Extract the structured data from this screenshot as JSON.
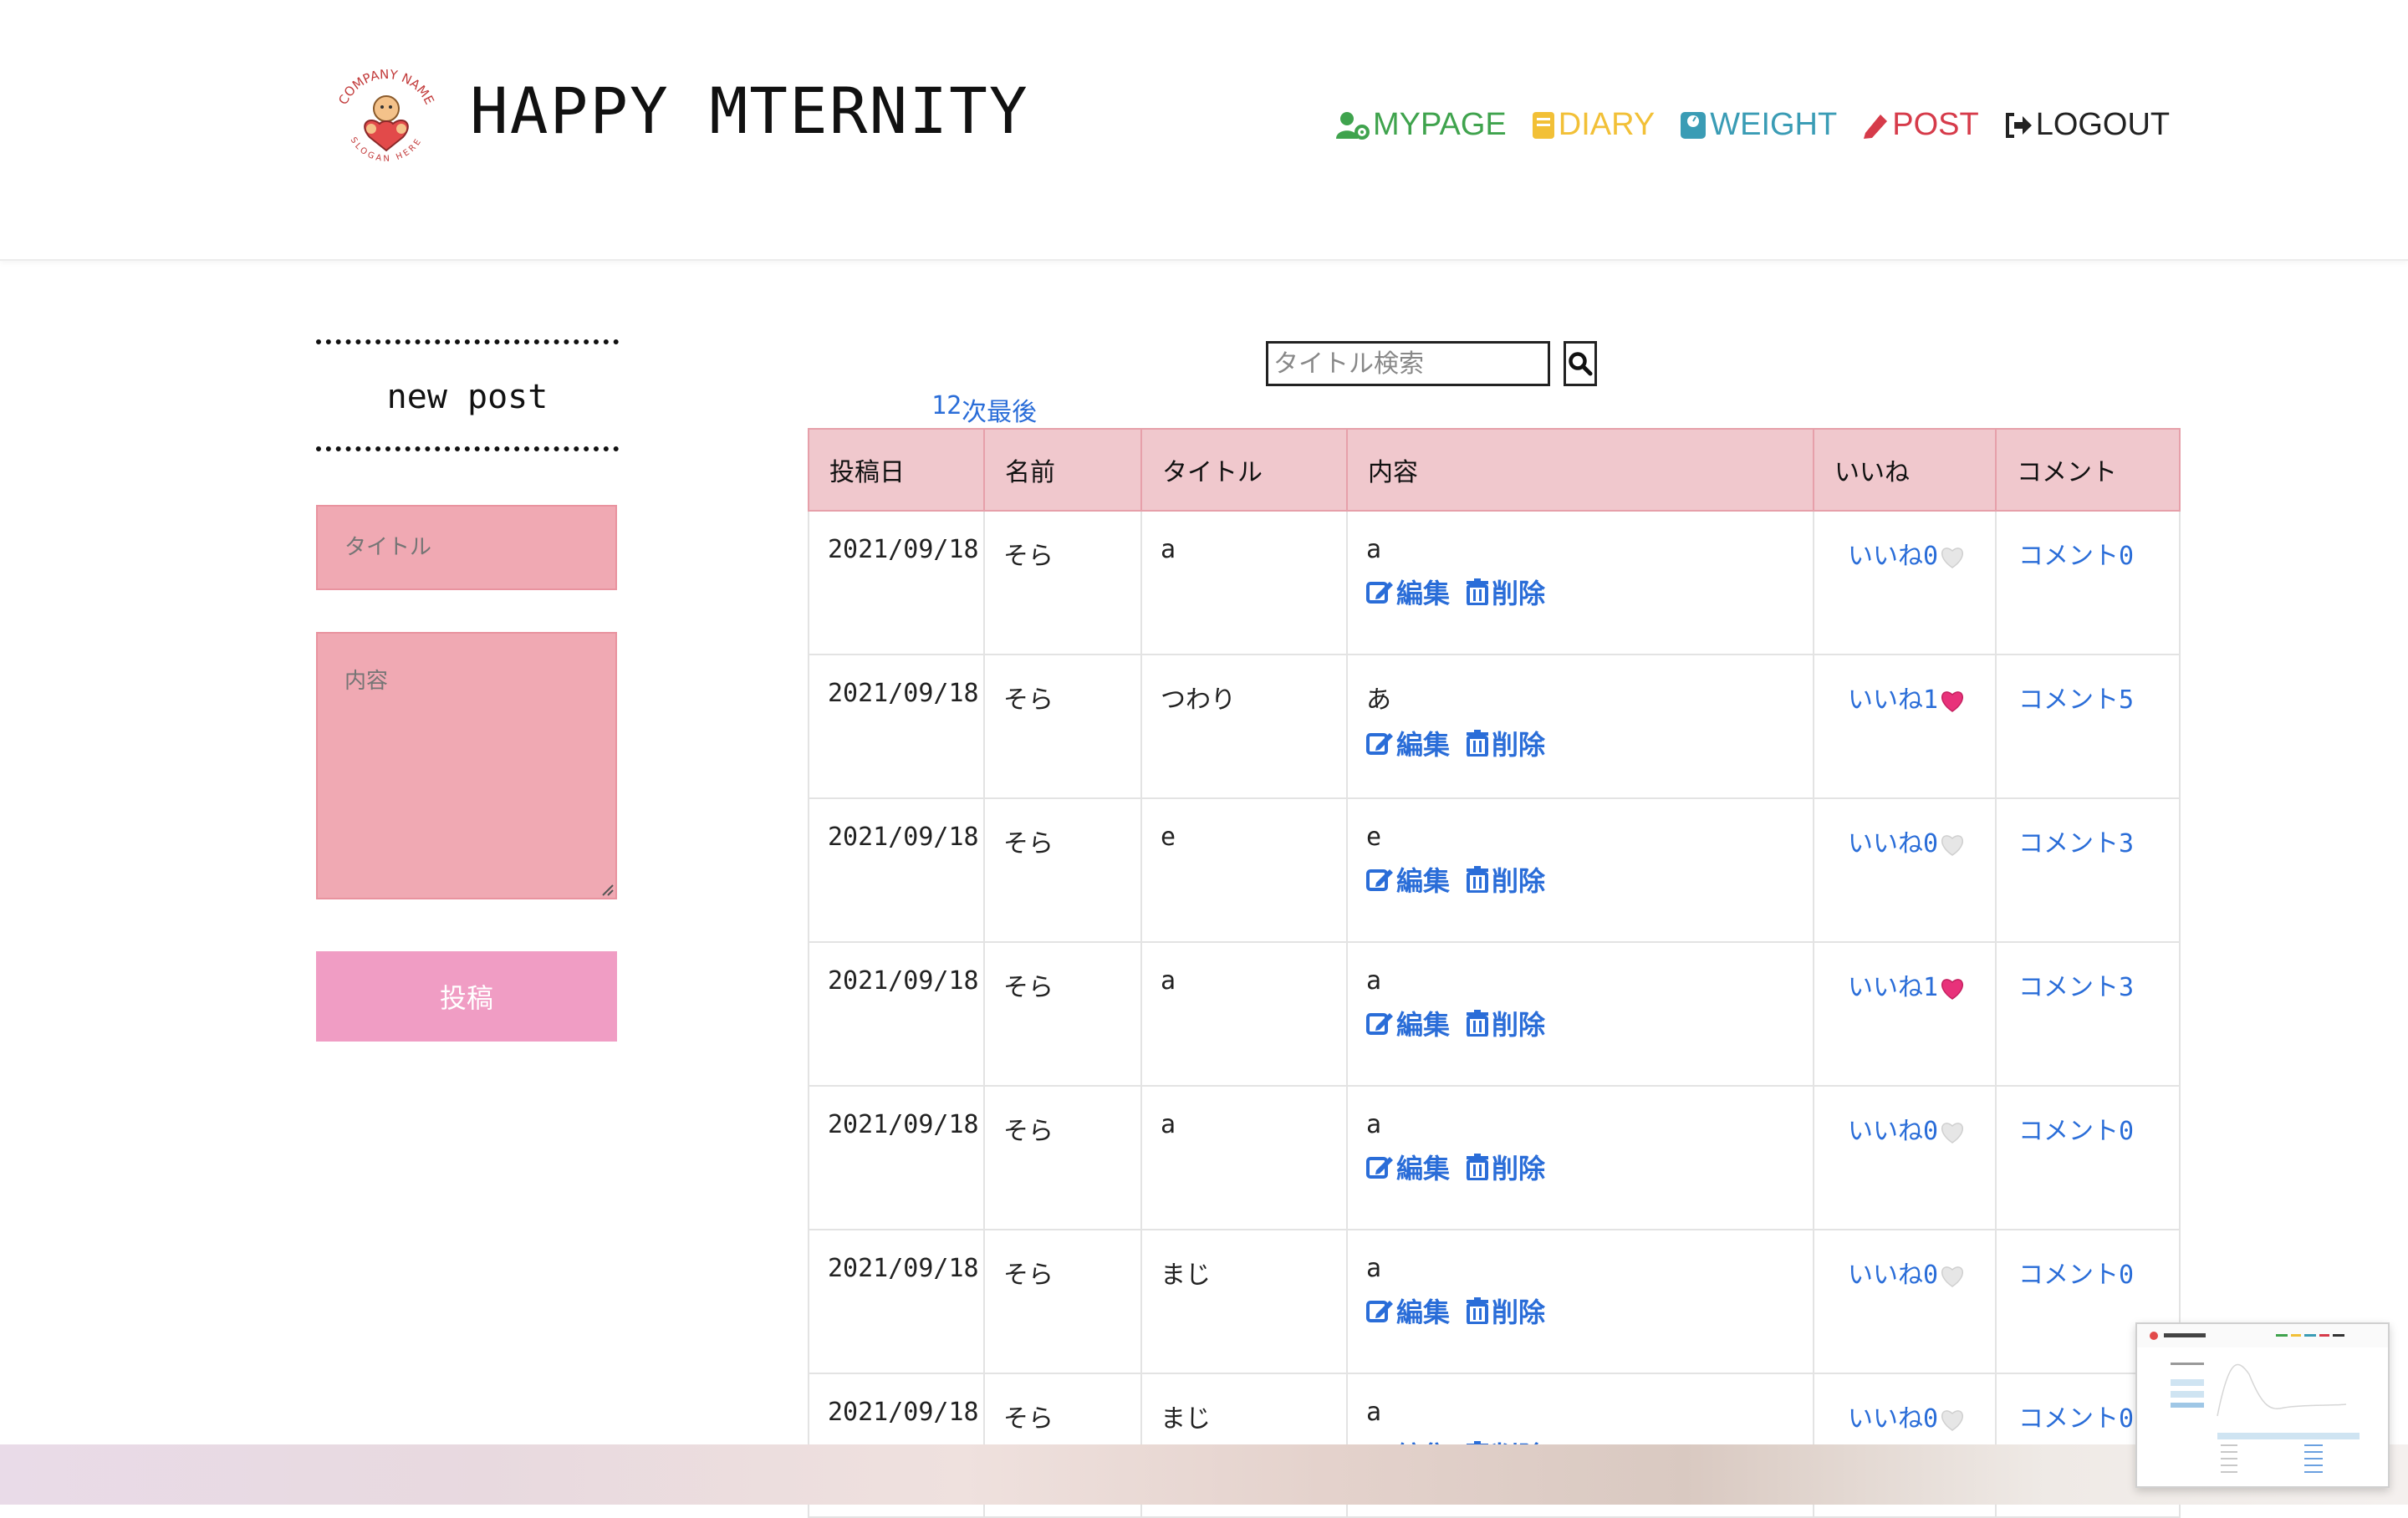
{
  "header": {
    "logo": {
      "icon": "baby-heart-logo",
      "text_top": "COMPANY NAME",
      "text_bottom": "SLOGAN HERE"
    },
    "site_title": "HAPPY MTERNITY",
    "nav": [
      {
        "label": "MYPAGE",
        "icon": "user-gear-icon",
        "color": "#3fa34d"
      },
      {
        "label": "DIARY",
        "icon": "book-icon",
        "color": "#f2c037"
      },
      {
        "label": "WEIGHT",
        "icon": "scale-icon",
        "color": "#3a9cb5"
      },
      {
        "label": "POST",
        "icon": "pencil-icon",
        "color": "#d63b4a"
      },
      {
        "label": "LOGOUT",
        "icon": "sign-out-icon",
        "color": "#222222"
      }
    ]
  },
  "sidebar": {
    "heading": "new post",
    "title_placeholder": "タイトル",
    "content_placeholder": "内容",
    "submit_label": "投稿"
  },
  "search": {
    "placeholder": "タイトル検索",
    "button_icon": "search-icon"
  },
  "pagination": {
    "pages": [
      "1",
      "2"
    ],
    "next": "次",
    "last": "最後"
  },
  "table": {
    "headers": [
      "投稿日",
      "名前",
      "タイトル",
      "内容",
      "いいね",
      "コメント"
    ],
    "edit_label": "編集",
    "delete_label": "削除",
    "rows": [
      {
        "date": "2021/09/18",
        "name": "そら",
        "title": "a",
        "content": "a",
        "like": "いいね0",
        "liked": false,
        "comment": "コメント0"
      },
      {
        "date": "2021/09/18",
        "name": "そら",
        "title": "つわり",
        "content": "あ",
        "like": "いいね1",
        "liked": true,
        "comment": "コメント5"
      },
      {
        "date": "2021/09/18",
        "name": "そら",
        "title": "e",
        "content": "e",
        "like": "いいね0",
        "liked": false,
        "comment": "コメント3"
      },
      {
        "date": "2021/09/18",
        "name": "そら",
        "title": "a",
        "content": "a",
        "like": "いいね1",
        "liked": true,
        "comment": "コメント3"
      },
      {
        "date": "2021/09/18",
        "name": "そら",
        "title": "a",
        "content": "a",
        "like": "いいね0",
        "liked": false,
        "comment": "コメント0"
      },
      {
        "date": "2021/09/18",
        "name": "そら",
        "title": "まじ",
        "content": "a",
        "like": "いいね0",
        "liked": false,
        "comment": "コメント0"
      },
      {
        "date": "2021/09/18",
        "name": "そら",
        "title": "まじ",
        "content": "a",
        "like": "いいね0",
        "liked": false,
        "comment": "コメント0"
      }
    ]
  },
  "colors": {
    "link": "#2a6dd8",
    "table_header_bg": "#f0c8cd",
    "input_bg": "#f0a9b3",
    "submit_bg": "#f09dc4",
    "heart_liked": "#e8327a",
    "heart_empty": "#e6e6e6"
  }
}
